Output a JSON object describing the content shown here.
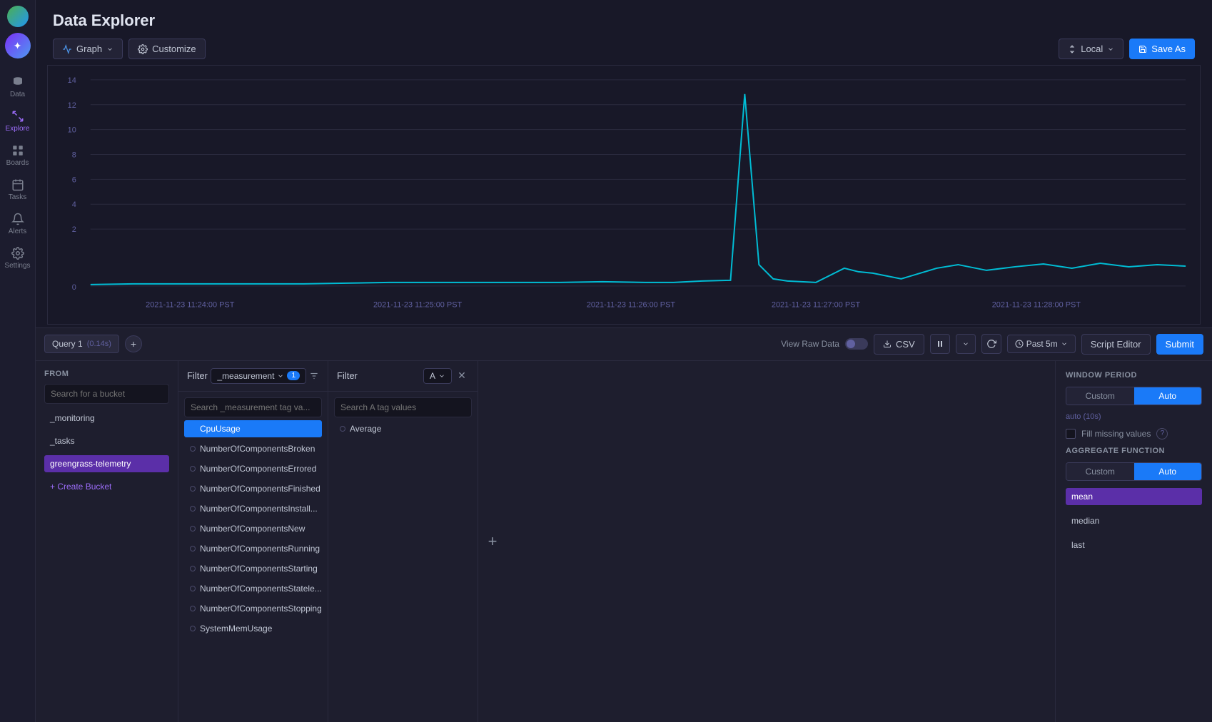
{
  "app": {
    "title": "Data Explorer"
  },
  "sidebar": {
    "logo_char": "✦",
    "items": [
      {
        "id": "data",
        "label": "Data",
        "icon": "database"
      },
      {
        "id": "explore",
        "label": "Explore",
        "icon": "explore",
        "active": true
      },
      {
        "id": "boards",
        "label": "Boards",
        "icon": "boards"
      },
      {
        "id": "tasks",
        "label": "Tasks",
        "icon": "tasks"
      },
      {
        "id": "alerts",
        "label": "Alerts",
        "icon": "alerts"
      },
      {
        "id": "settings",
        "label": "Settings",
        "icon": "settings"
      }
    ]
  },
  "toolbar": {
    "graph_label": "Graph",
    "customize_label": "Customize",
    "time_label": "Local",
    "save_as_label": "Save As"
  },
  "chart": {
    "x_labels": [
      "2021-11-23 11:24:00 PST",
      "2021-11-23 11:25:00 PST",
      "2021-11-23 11:26:00 PST",
      "2021-11-23 11:27:00 PST",
      "2021-11-23 11:28:00 PST"
    ],
    "y_labels": [
      "0",
      "2",
      "4",
      "6",
      "8",
      "10",
      "12",
      "14"
    ]
  },
  "query_bar": {
    "tab_label": "Query 1",
    "tab_time": "0.14s",
    "view_raw_label": "View Raw Data",
    "csv_label": "CSV",
    "time_range_label": "Past 5m",
    "script_editor_label": "Script Editor",
    "submit_label": "Submit"
  },
  "from_panel": {
    "label": "FROM",
    "search_placeholder": "Search for a bucket",
    "buckets": [
      {
        "name": "_monitoring",
        "selected": false
      },
      {
        "name": "_tasks",
        "selected": false
      },
      {
        "name": "greengrass-telemetry",
        "selected": true
      }
    ],
    "create_bucket_label": "+ Create Bucket"
  },
  "filter_panel_1": {
    "label": "Filter",
    "dropdown_value": "_measurement",
    "badge": "1",
    "search_placeholder": "Search _measurement tag va...",
    "items": [
      {
        "name": "CpuUsage",
        "selected": true
      },
      {
        "name": "NumberOfComponentsBroken",
        "selected": false
      },
      {
        "name": "NumberOfComponentsErrored",
        "selected": false
      },
      {
        "name": "NumberOfComponentsFinished",
        "selected": false
      },
      {
        "name": "NumberOfComponentsInstall...",
        "selected": false
      },
      {
        "name": "NumberOfComponentsNew",
        "selected": false
      },
      {
        "name": "NumberOfComponentsRunning",
        "selected": false
      },
      {
        "name": "NumberOfComponentsStarting",
        "selected": false
      },
      {
        "name": "NumberOfComponentsStatele...",
        "selected": false
      },
      {
        "name": "NumberOfComponentsStopping",
        "selected": false
      },
      {
        "name": "SystemMemUsage",
        "selected": false
      }
    ]
  },
  "filter_panel_2": {
    "label": "Filter",
    "dropdown_value": "A",
    "search_placeholder": "Search A tag values",
    "items": [
      {
        "name": "Average",
        "selected": false
      }
    ]
  },
  "window_period": {
    "label": "WINDOW PERIOD",
    "custom_label": "Custom",
    "auto_label": "Auto",
    "auto_hint": "auto (10s)",
    "fill_missing_label": "Fill missing values",
    "aggregate_label": "AGGREGATE FUNCTION",
    "custom2_label": "Custom",
    "auto2_label": "Auto",
    "agg_options": [
      {
        "name": "mean",
        "selected": true
      },
      {
        "name": "median",
        "selected": false
      },
      {
        "name": "last",
        "selected": false
      }
    ]
  }
}
